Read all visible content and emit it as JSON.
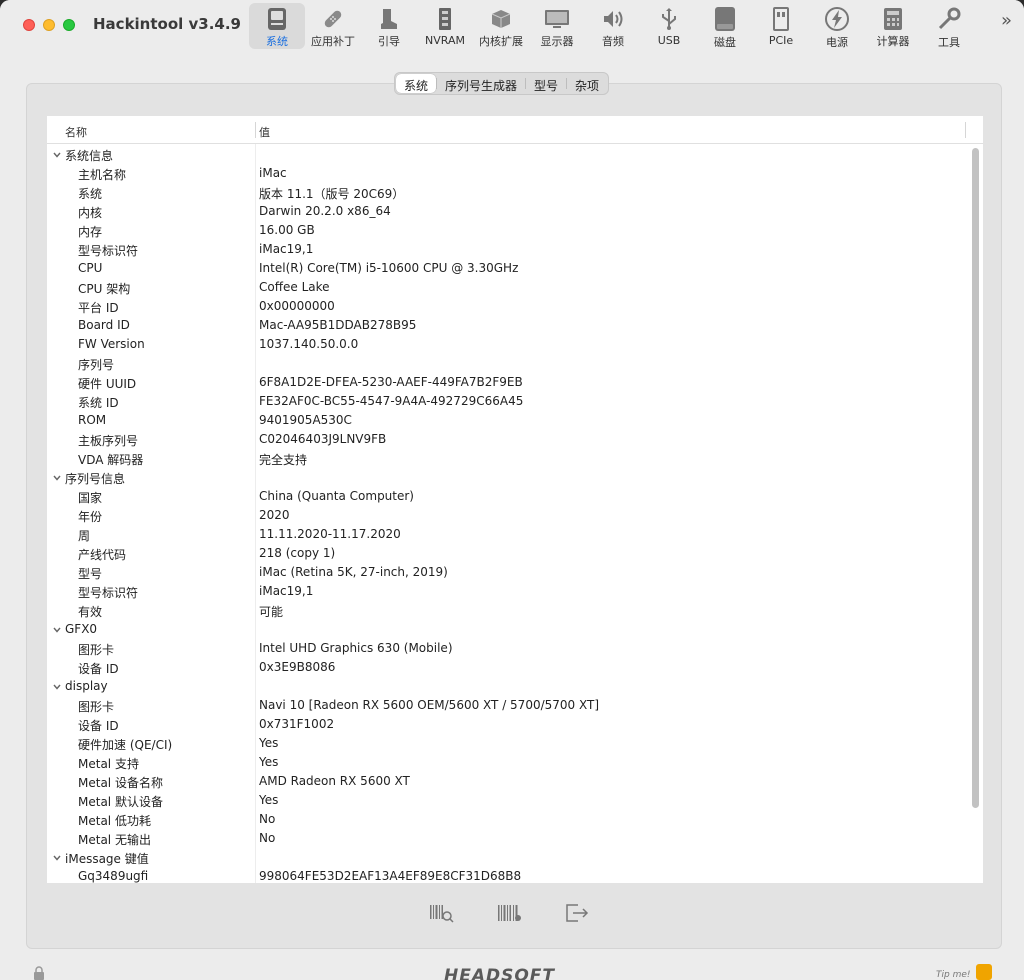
{
  "app": {
    "title": "Hackintool v3.4.9"
  },
  "toolbar": {
    "items": [
      {
        "label": "系统",
        "icon": "system-icon",
        "active": true
      },
      {
        "label": "应用补丁",
        "icon": "patch-icon"
      },
      {
        "label": "引导",
        "icon": "boot-icon"
      },
      {
        "label": "NVRAM",
        "icon": "nvram-icon"
      },
      {
        "label": "内核扩展",
        "icon": "kext-icon"
      },
      {
        "label": "显示器",
        "icon": "display-icon"
      },
      {
        "label": "音频",
        "icon": "audio-icon"
      },
      {
        "label": "USB",
        "icon": "usb-icon"
      },
      {
        "label": "磁盘",
        "icon": "disk-icon"
      },
      {
        "label": "PCIe",
        "icon": "pcie-icon"
      },
      {
        "label": "电源",
        "icon": "power-icon"
      },
      {
        "label": "计算器",
        "icon": "calculator-icon"
      },
      {
        "label": "工具",
        "icon": "tools-icon"
      }
    ],
    "more": "»"
  },
  "tabs": [
    "系统",
    "序列号生成器",
    "型号",
    "杂项"
  ],
  "table": {
    "headers": {
      "name": "名称",
      "value": "值"
    },
    "rows": [
      {
        "type": "group",
        "name": "系统信息",
        "value": ""
      },
      {
        "type": "child",
        "name": "主机名称",
        "value": "iMac"
      },
      {
        "type": "child",
        "name": "系统",
        "value": " 版本 11.1（版号 20C69）"
      },
      {
        "type": "child",
        "name": "内核",
        "value": "Darwin 20.2.0 x86_64"
      },
      {
        "type": "child",
        "name": "内存",
        "value": "16.00 GB"
      },
      {
        "type": "child",
        "name": "型号标识符",
        "value": "iMac19,1"
      },
      {
        "type": "child",
        "name": "CPU",
        "value": "Intel(R) Core(TM) i5-10600 CPU @ 3.30GHz"
      },
      {
        "type": "child",
        "name": "CPU 架构",
        "value": "Coffee Lake"
      },
      {
        "type": "child",
        "name": "平台 ID",
        "value": "0x00000000"
      },
      {
        "type": "child",
        "name": "Board ID",
        "value": "Mac-AA95B1DDAB278B95"
      },
      {
        "type": "child",
        "name": "FW Version",
        "value": "1037.140.50.0.0"
      },
      {
        "type": "child",
        "name": "序列号",
        "value": ""
      },
      {
        "type": "child",
        "name": "硬件 UUID",
        "value": "6F8A1D2E-DFEA-5230-AAEF-449FA7B2F9EB"
      },
      {
        "type": "child",
        "name": "系统 ID",
        "value": "FE32AF0C-BC55-4547-9A4A-492729C66A45"
      },
      {
        "type": "child",
        "name": "ROM",
        "value": "9401905A530C"
      },
      {
        "type": "child",
        "name": "主板序列号",
        "value": "C02046403J9LNV9FB"
      },
      {
        "type": "child",
        "name": "VDA 解码器",
        "value": "完全支持"
      },
      {
        "type": "group",
        "name": "序列号信息",
        "value": ""
      },
      {
        "type": "child",
        "name": "国家",
        "value": "China (Quanta Computer)"
      },
      {
        "type": "child",
        "name": "年份",
        "value": "2020"
      },
      {
        "type": "child",
        "name": "周",
        "value": "11.11.2020-11.17.2020"
      },
      {
        "type": "child",
        "name": "产线代码",
        "value": "218 (copy 1)"
      },
      {
        "type": "child",
        "name": "型号",
        "value": "iMac (Retina 5K, 27-inch, 2019)"
      },
      {
        "type": "child",
        "name": "型号标识符",
        "value": "iMac19,1"
      },
      {
        "type": "child",
        "name": "有效",
        "value": "可能"
      },
      {
        "type": "group",
        "name": "GFX0",
        "value": ""
      },
      {
        "type": "child",
        "name": "图形卡",
        "value": "Intel UHD Graphics 630 (Mobile)"
      },
      {
        "type": "child",
        "name": "设备 ID",
        "value": "0x3E9B8086"
      },
      {
        "type": "group",
        "name": "display",
        "value": ""
      },
      {
        "type": "child",
        "name": "图形卡",
        "value": "Navi 10 [Radeon RX 5600 OEM/5600 XT / 5700/5700 XT]"
      },
      {
        "type": "child",
        "name": "设备 ID",
        "value": "0x731F1002"
      },
      {
        "type": "child",
        "name": "硬件加速 (QE/CI)",
        "value": "Yes"
      },
      {
        "type": "child",
        "name": "Metal 支持",
        "value": "Yes"
      },
      {
        "type": "child",
        "name": "Metal 设备名称",
        "value": "AMD Radeon RX 5600 XT"
      },
      {
        "type": "child",
        "name": "Metal 默认设备",
        "value": "Yes"
      },
      {
        "type": "child",
        "name": "Metal 低功耗",
        "value": "No"
      },
      {
        "type": "child",
        "name": "Metal 无输出",
        "value": "No"
      },
      {
        "type": "group",
        "name": "iMessage 键值",
        "value": ""
      },
      {
        "type": "child",
        "name": "Gq3489ugfi",
        "value": "998064FE53D2EAF13A4EF89E8CF31D68B8"
      }
    ]
  },
  "footer": {
    "logo": "HEADSOFT",
    "tip": "Tip me!"
  },
  "colors": {
    "accent": "#1a6fe0",
    "close": "#fe5f57",
    "minimize": "#febc2e",
    "maximize": "#28c840"
  }
}
